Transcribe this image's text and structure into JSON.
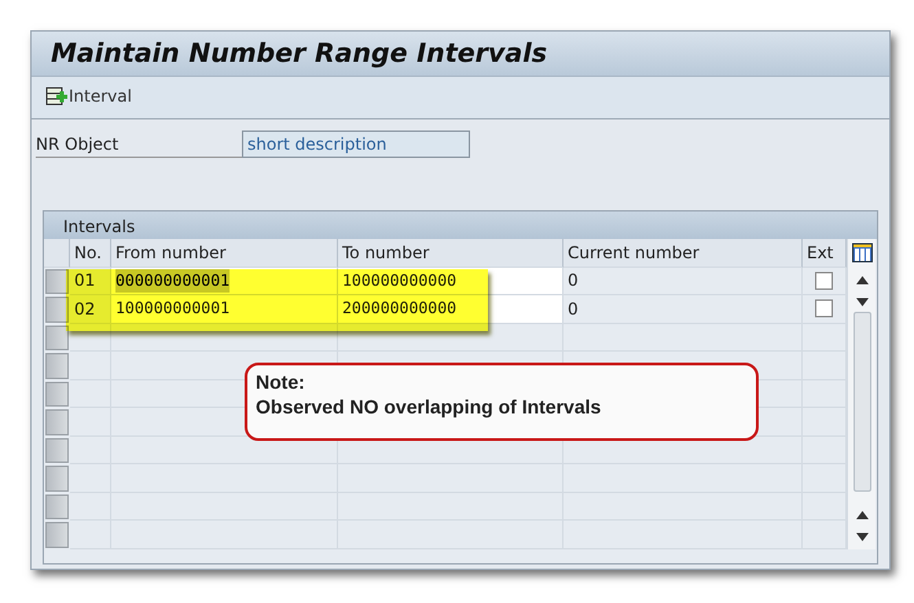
{
  "window": {
    "title": "Maintain Number Range Intervals"
  },
  "toolbar": {
    "button": "Interval"
  },
  "nr_object": {
    "label": "NR Object",
    "value": "short description"
  },
  "intervals": {
    "title": "Intervals",
    "columns": [
      "No.",
      "From number",
      "To number",
      "Current number",
      "Ext"
    ],
    "rows": [
      {
        "no": "01",
        "from": "000000000001",
        "to": "100000000000",
        "current": "0",
        "ext_checked": false,
        "selected": true
      },
      {
        "no": "02",
        "from": "100000000001",
        "to": "200000000000",
        "current": "0",
        "ext_checked": false,
        "selected": false
      }
    ]
  },
  "note": {
    "title": "Note:",
    "text": "Observed NO overlapping of Intervals"
  }
}
